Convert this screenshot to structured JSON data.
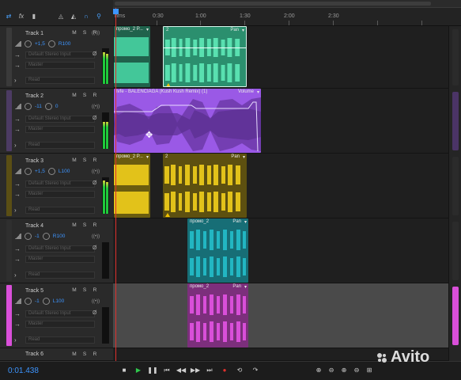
{
  "ruler": {
    "ticks": [
      "hms",
      "0:30",
      "1:00",
      "1:30",
      "2:00",
      "2:30"
    ]
  },
  "header": {
    "tools": [
      "swap-icon",
      "fx-icon",
      "meter-icon",
      "input-icon",
      "output-icon",
      "headphones-icon",
      "marker-icon"
    ]
  },
  "tracks": [
    {
      "name": "Track 1",
      "volume": "+1,5",
      "pan": "R100",
      "input": "Default Stereo Input",
      "output": "Master",
      "mode": "Read",
      "color": "#43c799"
    },
    {
      "name": "Track 2",
      "volume": "-11",
      "pan": "0",
      "input": "Default Stereo Input",
      "output": "Master",
      "mode": "Read",
      "color": "#a463f0"
    },
    {
      "name": "Track 3",
      "volume": "+1,5",
      "pan": "L100",
      "input": "Default Stereo Input",
      "output": "Master",
      "mode": "Read",
      "color": "#e2c21a"
    },
    {
      "name": "Track 4",
      "volume": "-1",
      "pan": "R100",
      "input": "Default Stereo Input",
      "output": "Master",
      "mode": "Read",
      "color": "#22b6c2"
    },
    {
      "name": "Track 5",
      "volume": "-1",
      "pan": "L100",
      "input": "Default Stereo Input",
      "output": "Master",
      "mode": "Read",
      "color": "#d94fd9"
    },
    {
      "name": "Track 6"
    }
  ],
  "msr": {
    "m": "M",
    "s": "S",
    "r": "R"
  },
  "clips": {
    "t1a": {
      "title": "промо_2 P...",
      "arrow": "▾"
    },
    "t1b": {
      "title": "2",
      "pan": "Pan",
      "arrow": "▾"
    },
    "t2a": {
      "title": "Ivfe - BALENCIAGA (Kush Kush Remix) (1)",
      "pan": "Volume",
      "arrow": "▾"
    },
    "t3a": {
      "title": "промо_2 P...",
      "arrow": "▾"
    },
    "t3b": {
      "title": "2",
      "pan": "Pan",
      "arrow": "▾"
    },
    "t4a": {
      "title": "промо_2",
      "pan": "Pan",
      "arrow": "▾"
    },
    "t5a": {
      "title": "промо_2",
      "pan": "Pan",
      "arrow": "▾"
    }
  },
  "transport": {
    "timecode": "0:01.438",
    "buttons": [
      "stop-icon",
      "play-icon",
      "pause-icon",
      "to-start-icon",
      "rewind-icon",
      "forward-icon",
      "to-end-icon",
      "record-icon",
      "loop-icon",
      "skip-icon"
    ]
  },
  "watermark": "Avito",
  "colors": {
    "accent": "#3d95ff",
    "playhead": "#e0302c"
  }
}
